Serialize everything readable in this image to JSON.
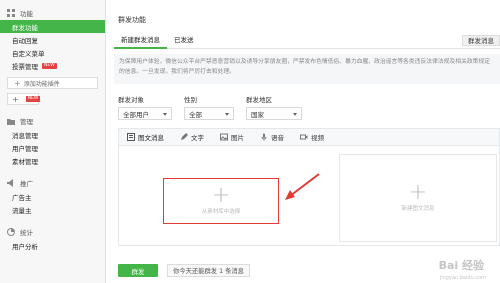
{
  "sidebar": {
    "sections": [
      {
        "title": "功能",
        "icon": "grid-icon",
        "items": [
          {
            "label": "群发功能",
            "active": true
          },
          {
            "label": "自动回复"
          },
          {
            "label": "自定义菜单"
          },
          {
            "label": "投票管理",
            "badge": "NEW"
          }
        ]
      },
      {
        "title": "管理",
        "icon": "folder-icon",
        "items": [
          {
            "label": "消息管理"
          },
          {
            "label": "用户管理"
          },
          {
            "label": "素材管理"
          }
        ]
      },
      {
        "title": "推广",
        "icon": "megaphone-icon",
        "items": [
          {
            "label": "广告主"
          },
          {
            "label": "流量主"
          }
        ]
      },
      {
        "title": "统计",
        "icon": "chart-icon",
        "items": [
          {
            "label": "用户分析"
          }
        ]
      }
    ],
    "add_plugin_label": "添加功能插件",
    "small_add_badge": "NEW"
  },
  "main": {
    "page_title": "群发功能",
    "tabs": [
      {
        "label": "新建群发消息",
        "active": true
      },
      {
        "label": "已发送"
      }
    ],
    "tab_right_label": "群发消息",
    "notice": "为保障用户体验，微信公众平台严禁恶意营销以及诱导分享朋友圈，严禁发布色情低俗、暴力血腥、政治谣言等各类违反法律法规及相关政策规定的信息。一旦发现，我们将严厉打击和处理。",
    "filters": [
      {
        "label": "群发对象",
        "value": "全部用户"
      },
      {
        "label": "性别",
        "value": "全部"
      },
      {
        "label": "群发地区",
        "value": "国家"
      }
    ],
    "toolbar": [
      {
        "label": "图文消息",
        "icon": "article-icon",
        "active": true
      },
      {
        "label": "文字",
        "icon": "pen-icon"
      },
      {
        "label": "图片",
        "icon": "image-icon"
      },
      {
        "label": "语音",
        "icon": "mic-icon"
      },
      {
        "label": "视频",
        "icon": "video-icon"
      }
    ],
    "panel_left_label": "从素材库中选择",
    "panel_right_label": "新建图文消息",
    "send_label": "群发",
    "remaining_text": "你今天还能群发 1 条消息"
  },
  "watermark": {
    "text": "Bai 经验",
    "sub": "jingyan.baidu.com"
  },
  "colors": {
    "accent": "#44b549",
    "highlight": "#e53935"
  }
}
